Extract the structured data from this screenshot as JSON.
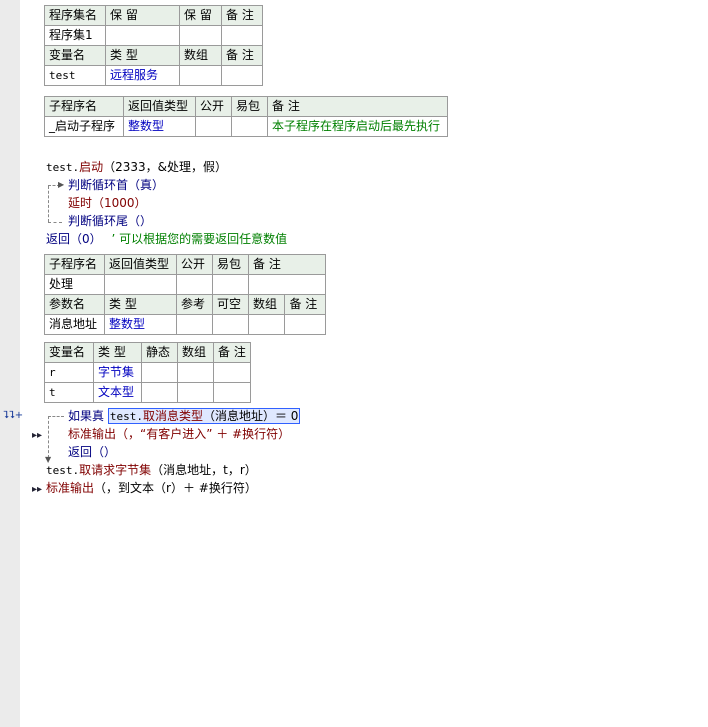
{
  "table1": {
    "header": [
      "程序集名",
      "保 留",
      "保 留",
      "备 注"
    ],
    "row": [
      "程序集1",
      "",
      "",
      ""
    ]
  },
  "table1b": {
    "header": [
      "变量名",
      "类 型",
      "数组",
      "备 注"
    ],
    "row": [
      "test",
      "远程服务",
      "",
      ""
    ]
  },
  "table2": {
    "header": [
      "子程序名",
      "返回值类型",
      "公开",
      "易包",
      "备 注"
    ],
    "row": [
      "_启动子程序",
      "整数型",
      "",
      "",
      "本子程序在程序启动后最先执行"
    ]
  },
  "code1": {
    "line1_obj": "test.",
    "line1_fn": "启动",
    "line1_args": "（2333，&处理，假）",
    "loop_start": "判断循环首（真）",
    "delay": "延时（1000）",
    "loop_end": "判断循环尾（）",
    "return_stmt": "返回（0）",
    "return_comment": "’ 可以根据您的需要返回任意数值"
  },
  "table3": {
    "header": [
      "子程序名",
      "返回值类型",
      "公开",
      "易包",
      "备 注"
    ],
    "row": [
      "处理",
      "",
      "",
      "",
      ""
    ],
    "param_header": [
      "参数名",
      "类 型",
      "参考",
      "可空",
      "数组",
      "备 注"
    ],
    "param_row": [
      "消息地址",
      "整数型",
      "",
      "",
      "",
      ""
    ]
  },
  "table4": {
    "header": [
      "变量名",
      "类 型",
      "静态",
      "数组",
      "备 注"
    ],
    "rows": [
      [
        "r",
        "字节集",
        "",
        "",
        ""
      ],
      [
        "t",
        "文本型",
        "",
        "",
        ""
      ]
    ]
  },
  "code2": {
    "if_kw": "如果真",
    "if_obj": "test.",
    "if_fn": "取消息类型",
    "if_args": "（消息地址）＝ 0",
    "print1": "标准输出（，“有客户进入” ＋ #换行符）",
    "ret": "返回（）",
    "get_obj": "test.",
    "get_fn": "取请求字节集",
    "get_args": "（消息地址，t，r）",
    "print2_fn": "标准输出",
    "print2_args": "（，到文本（r）＋ #换行符）"
  },
  "colors": {
    "keyword": "#000080",
    "function": "#800000",
    "type": "#0000c0",
    "comment": "#008000",
    "header_bg": "#e8f0e8",
    "gutter_bg": "#ebebeb"
  }
}
